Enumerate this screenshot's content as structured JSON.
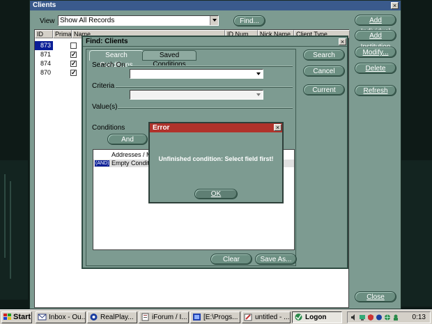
{
  "clients_window": {
    "title": "Clients",
    "view_label": "View",
    "view_selected": "Show All Records",
    "find_button": "Find...",
    "columns": [
      "ID",
      "Primary",
      "Name",
      "ID Num",
      "Nick Name",
      "Client Type"
    ],
    "rows": [
      {
        "id": "873",
        "primary": false,
        "selected": true
      },
      {
        "id": "871",
        "primary": true,
        "selected": false
      },
      {
        "id": "874",
        "primary": true,
        "selected": false
      },
      {
        "id": "870",
        "primary": true,
        "selected": false
      }
    ],
    "side_buttons": {
      "add_individual": "Add Individual",
      "add_institution": "Add Institution",
      "modify": "Modify...",
      "delete": "Delete",
      "refresh": "Refresh",
      "close": "Close"
    }
  },
  "find_dialog": {
    "title": "Find: Clients",
    "tabs": [
      "Search Conditions",
      "Saved Conditions"
    ],
    "search_on_label": "Search On",
    "criteria_label": "Criteria",
    "values_label": "Value(s)",
    "conditions_label": "Conditions",
    "and_button": "And",
    "conditions_list": [
      "Addresses / M",
      "Empty Conditio"
    ],
    "condition_badge": "(AND)",
    "buttons": {
      "search": "Search",
      "cancel": "Cancel",
      "current": "Current",
      "clear": "Clear",
      "save_as": "Save As..."
    }
  },
  "error_dialog": {
    "title": "Error",
    "message": "Unfinished condition: Select field first!",
    "ok_button": "OK"
  },
  "taskbar": {
    "start": "Start",
    "tasks": [
      {
        "label": "Inbox - Ou...",
        "icon": "inbox-icon",
        "active": false
      },
      {
        "label": "RealPlay...",
        "icon": "realplayer-icon",
        "active": false
      },
      {
        "label": "iForum / I...",
        "icon": "document-icon",
        "active": false
      },
      {
        "label": "[E:\\Progs...",
        "icon": "folder-icon",
        "active": false
      },
      {
        "label": "untitled - ...",
        "icon": "paint-icon",
        "active": false
      },
      {
        "label": "Logon",
        "icon": "logon-icon",
        "active": true
      }
    ],
    "clock": "0:13"
  },
  "colors": {
    "window_green": "#7d9b91",
    "titlebar_blue": "#3a5a8c",
    "error_titlebar": "#b0322b",
    "selection": "#0a1e96"
  }
}
